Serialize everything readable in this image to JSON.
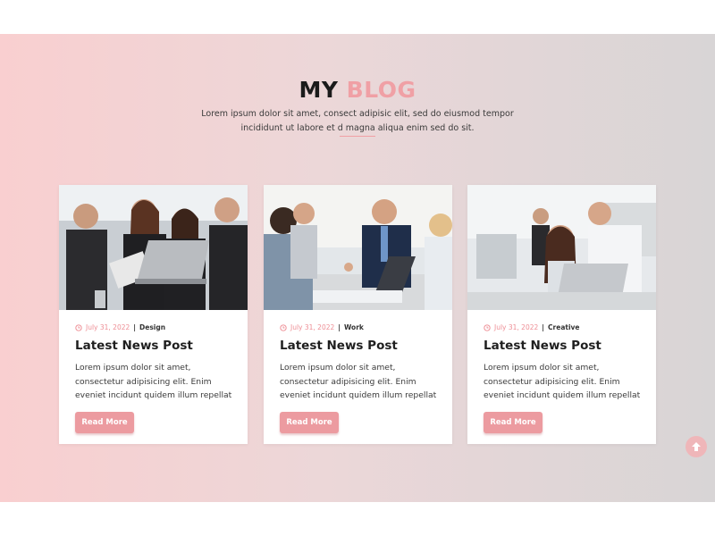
{
  "section": {
    "title_part1": "MY",
    "title_part2": "BLOG",
    "subtitle": "Lorem ipsum dolor sit amet, consect adipisic elit, sed do eiusmod tempor incididunt ut labore et d magna aliqua enim sed do sit."
  },
  "posts": [
    {
      "date": "July 31, 2022",
      "category": "Design",
      "title": "Latest News Post",
      "excerpt": "Lorem ipsum dolor sit amet, consectetur adipisicing elit. Enim eveniet incidunt quidem illum repellat",
      "button": "Read More"
    },
    {
      "date": "July 31, 2022",
      "category": "Work",
      "title": "Latest News Post",
      "excerpt": "Lorem ipsum dolor sit amet, consectetur adipisicing elit. Enim eveniet incidunt quidem illum repellat",
      "button": "Read More"
    },
    {
      "date": "July 31, 2022",
      "category": "Creative",
      "title": "Latest News Post",
      "excerpt": "Lorem ipsum dolor sit amet, consectetur adipisicing elit. Enim eveniet incidunt quidem illum repellat",
      "button": "Read More"
    }
  ],
  "meta_separator": "|",
  "icons": {
    "date": "clock-icon",
    "scroll_top": "arrow-up-icon"
  },
  "colors": {
    "accent": "#ec9ba0",
    "title_accent": "#f0a0a5",
    "date": "#ee8e95"
  }
}
